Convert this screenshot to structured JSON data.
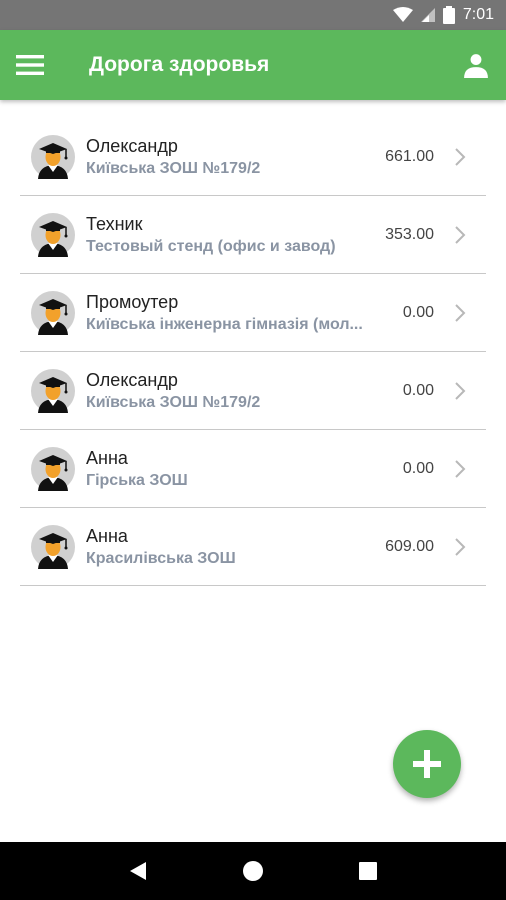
{
  "status_bar": {
    "time": "7:01",
    "battery_text": "B"
  },
  "app_bar": {
    "title": "Дорога здоровья",
    "menu_icon": "hamburger-menu-icon",
    "profile_icon": "person-icon"
  },
  "colors": {
    "primary": "#5cb85c",
    "status_bar": "#757575",
    "school_text": "#8a94a3",
    "divider": "#c8c8c8"
  },
  "students": [
    {
      "name": "Олександр",
      "school": "Київська ЗОШ №179/2",
      "amount": "661.00"
    },
    {
      "name": "Техник",
      "school": "Тестовый стенд (офис и завод)",
      "amount": "353.00"
    },
    {
      "name": "Промоутер",
      "school": "Київська інженерна гімназія (мол...",
      "amount": "0.00"
    },
    {
      "name": "Олександр",
      "school": "Київська ЗОШ №179/2",
      "amount": "0.00"
    },
    {
      "name": "Анна",
      "school": "Гірська ЗОШ",
      "amount": "0.00"
    },
    {
      "name": "Анна",
      "school": "Красилівська ЗОШ",
      "amount": "609.00"
    }
  ],
  "fab": {
    "icon": "plus-icon"
  },
  "nav_bar": {
    "back_icon": "back-triangle-icon",
    "home_icon": "home-circle-icon",
    "recents_icon": "recents-square-icon"
  }
}
